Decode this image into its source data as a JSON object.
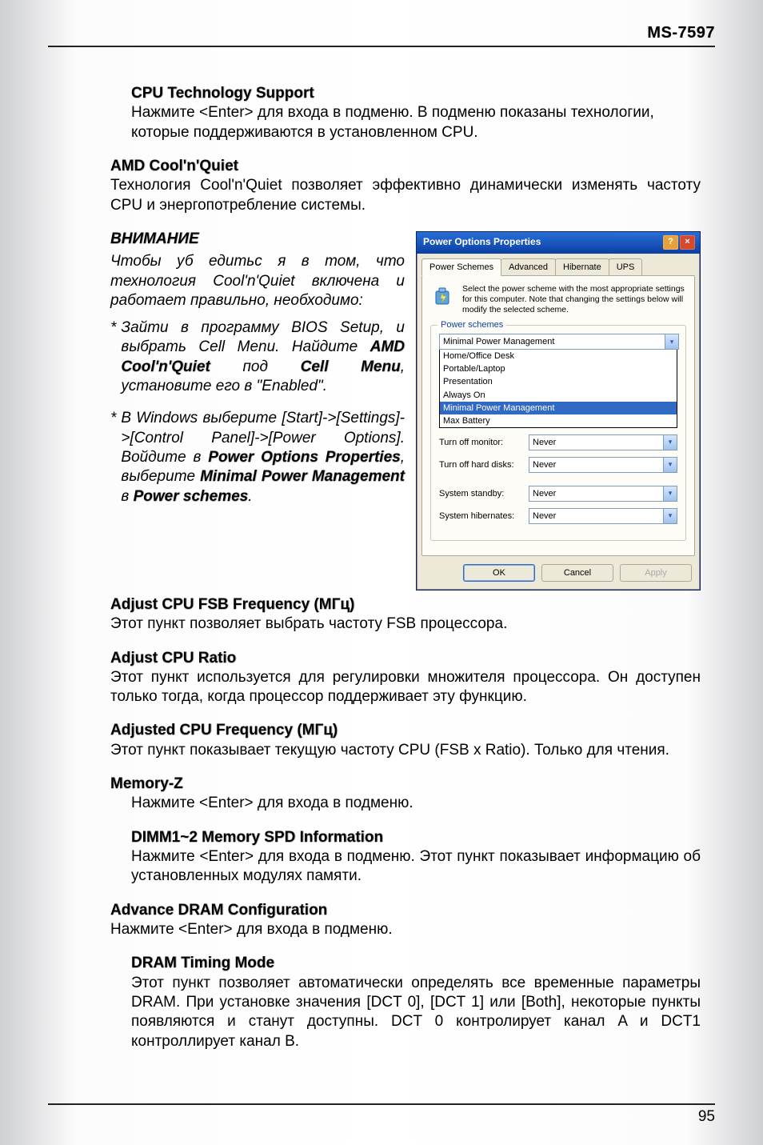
{
  "header": {
    "model": "MS-7597"
  },
  "footer": {
    "page": "95"
  },
  "sections": {
    "cpu_tech": {
      "title": "CPU Technology Support",
      "body": "Нажмите <Enter> для входа в подменю. В подменю показаны технологии, которые поддерживаются в установленном CPU."
    },
    "amd": {
      "title": "AMD Cool'n'Quiet",
      "body": "Технология Cool'n'Quiet позволяет эффективно динамически изменять частоту CPU и энергопотребление системы."
    },
    "attention": {
      "title": "ВНИМАНИЕ",
      "intro": "Чтобы уб едитьс я в том, что технология Cool'n'Quiet включена и работает правильно, необходимо:",
      "b1_pre": "Зайти в программу BIOS Setup, и выбрать Cell Menu. Найдите ",
      "b1_bold1": "AMD Cool'n'Quiet",
      "b1_mid": " под ",
      "b1_bold2": "Cell Menu",
      "b1_post": ", установите его в \"Enabled\".",
      "b2_pre": "В Windows выберите [Start]->[Settings]->[Control Panel]->[Power Options]. Войдите в ",
      "b2_bold1": "Power Options Properties",
      "b2_mid": ", выберите ",
      "b2_bold2": "Minimal Power Management",
      "b2_mid2": " в ",
      "b2_bold3": "Power schemes",
      "b2_post": "."
    },
    "fsb": {
      "title": "Adjust CPU FSB Frequency (МГц)",
      "body": "Этот пункт позволяет выбрать частоту FSB процессора."
    },
    "ratio": {
      "title": "Adjust CPU Ratio",
      "body": "Этот пункт используется для регулировки множителя процессора. Он доступен только тогда, когда процессор поддерживает эту функцию."
    },
    "adjfreq": {
      "title": "Adjusted CPU Frequency (МГц)",
      "body": "Этот пункт показывает текущую частоту CPU (FSB x Ratio). Только для чтения."
    },
    "memz": {
      "title": "Memory-Z",
      "body": "Нажмите <Enter> для входа в подменю."
    },
    "dimm": {
      "title": "DIMM1~2 Memory SPD Information",
      "body": "Нажмите <Enter> для входа в подменю. Этот пункт показывает информацию об установленных модулях памяти."
    },
    "advdram": {
      "title": "Advance DRAM Configuration",
      "body": "Нажмите <Enter> для входа в подменю."
    },
    "dramtm": {
      "title": "DRAM Timing Mode",
      "body": "Этот пункт позволяет автоматически определять все временные параметры DRAM. При установке значения [DCT 0], [DCT 1] или [Both], некоторые пункты появляются и станут доступны. DCT 0 контролирует канал A и DCT1 контроллирует канал B."
    }
  },
  "dialog": {
    "title": "Power Options Properties",
    "tabs": [
      "Power Schemes",
      "Advanced",
      "Hibernate",
      "UPS"
    ],
    "intro": "Select the power scheme with the most appropriate settings for this computer. Note that changing the settings below will modify the selected scheme.",
    "legend": "Power schemes",
    "selected": "Minimal Power Management",
    "options": [
      "Home/Office Desk",
      "Portable/Laptop",
      "Presentation",
      "Always On",
      "Minimal Power Management",
      "Max Battery"
    ],
    "rows": {
      "monitor": {
        "label": "Turn off monitor:",
        "value": "Never"
      },
      "disks": {
        "label": "Turn off hard disks:",
        "value": "Never"
      },
      "standby": {
        "label": "System standby:",
        "value": "Never"
      },
      "hiber": {
        "label": "System hibernates:",
        "value": "Never"
      }
    },
    "buttons": {
      "ok": "OK",
      "cancel": "Cancel",
      "apply": "Apply"
    }
  }
}
